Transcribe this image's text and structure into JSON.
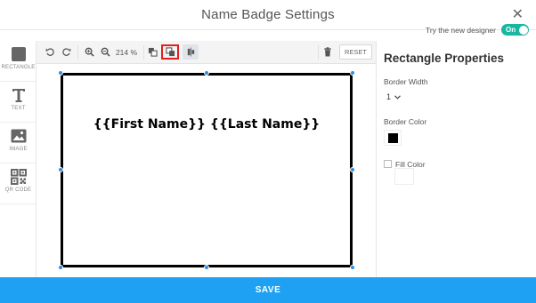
{
  "header": {
    "title": "Name Badge Settings",
    "close_glyph": "✕",
    "designer_label": "Try the new designer",
    "designer_toggle": "On",
    "accent_color": "#19b6a0"
  },
  "palette": {
    "items": [
      {
        "label": "RECTANGLE",
        "icon": "rectangle-icon"
      },
      {
        "label": "TEXT",
        "icon": "text-icon"
      },
      {
        "label": "IMAGE",
        "icon": "image-icon"
      },
      {
        "label": "QR CODE",
        "icon": "qr-code-icon"
      }
    ]
  },
  "toolbar": {
    "zoom_value": "214 %",
    "reset_label": "RESET",
    "highlight_color": "#e02020"
  },
  "canvas": {
    "badge_text": "{{First Name}} {{Last Name}}",
    "handle_color": "#2f8de4"
  },
  "properties": {
    "title": "Rectangle Properties",
    "border_width_label": "Border Width",
    "border_width_value": "1",
    "border_color_label": "Border Color",
    "border_color_value": "#000000",
    "fill_color_label": "Fill Color",
    "fill_enabled": false
  },
  "footer": {
    "save_label": "SAVE",
    "save_color": "#1ea1f2"
  }
}
